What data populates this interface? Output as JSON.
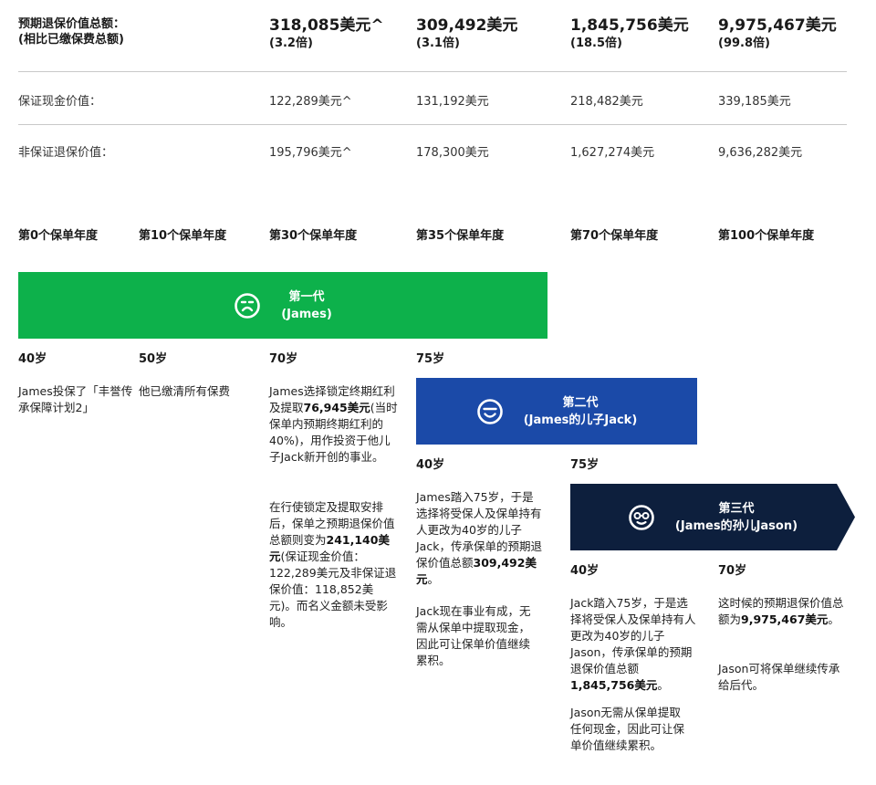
{
  "summary": {
    "total_label_1": "预期退保价值总额：",
    "total_label_2": "(相比已缴保费总额)",
    "cash_label": "保证现金价值：",
    "non_guaranteed_label": "非保证退保价值："
  },
  "columns": [
    {
      "year": "第0个保单年度"
    },
    {
      "year": "第10个保单年度"
    },
    {
      "year": "第30个保单年度",
      "total": "318,085美元^",
      "multiple": "(3.2倍)",
      "cash": "122,289美元^",
      "non_guaranteed": "195,796美元^"
    },
    {
      "year": "第35个保单年度",
      "total": "309,492美元",
      "multiple": "(3.1倍)",
      "cash": "131,192美元",
      "non_guaranteed": "178,300美元"
    },
    {
      "year": "第70个保单年度",
      "total": "1,845,756美元",
      "multiple": "(18.5倍)",
      "cash": "218,482美元",
      "non_guaranteed": "1,627,274美元"
    },
    {
      "year": "第100个保单年度",
      "total": "9,975,467美元",
      "multiple": "(99.8倍)",
      "cash": "339,185美元",
      "non_guaranteed": "9,636,282美元"
    }
  ],
  "generations": [
    {
      "title": "第一代",
      "subtitle": "(James)",
      "color": "#0db14b",
      "icon": "sad-face-icon"
    },
    {
      "title": "第二代",
      "subtitle": "(James的儿子Jack)",
      "color": "#1b4aa8",
      "icon": "smile-face-icon"
    },
    {
      "title": "第三代",
      "subtitle": "(James的孙儿Jason)",
      "color": "#0d1f3d",
      "icon": "glasses-face-icon"
    }
  ],
  "ages": {
    "gen1_c1": "40岁",
    "gen1_c2": "50岁",
    "gen1_c3": "70岁",
    "gen1_c4": "75岁",
    "gen2_c4": "40岁",
    "gen2_c5": "75岁",
    "gen3_c5": "40岁",
    "gen3_c6": "70岁"
  },
  "texts": {
    "c1": "James投保了「丰誉传承保障计划2」",
    "c2": "他已缴清所有保费",
    "c3p1_a": "James选择锁定终期红利及提取",
    "c3p1_b": "76,945美元",
    "c3p1_c": "(当时保单内预期终期红利的40%)，用作投资于他儿子Jack新开创的事业。",
    "c3p2_a": "在行使锁定及提取安排后，保单之预期退保价值总额则变为",
    "c3p2_b": "241,140美元",
    "c3p2_c": "(保证现金价值：122,289美元及非保证退保价值：118,852美元)。而名义金额未受影响。",
    "c4p1_a": "James踏入75岁，于是选择将受保人及保单持有人更改为40岁的儿子 Jack，传承保单的预期退保价值总额",
    "c4p1_b": "309,492美元",
    "c4p1_c": "。",
    "c4p2": "Jack现在事业有成，无需从保单中提取现金，因此可让保单价值继续累积。",
    "c5p1_a": "Jack踏入75岁，于是选择将受保人及保单持有人更改为40岁的儿子Jason，传承保单的预期退保价值总额",
    "c5p1_b": "1,845,756美元",
    "c5p1_c": "。",
    "c5p2": "Jason无需从保单提取任何现金，因此可让保单价值继续累积。",
    "c6p1_a": "这时候的预期退保价值总额为",
    "c6p1_b": "9,975,467美元",
    "c6p1_c": "。",
    "c6p2": "Jason可将保单继续传承给后代。"
  }
}
